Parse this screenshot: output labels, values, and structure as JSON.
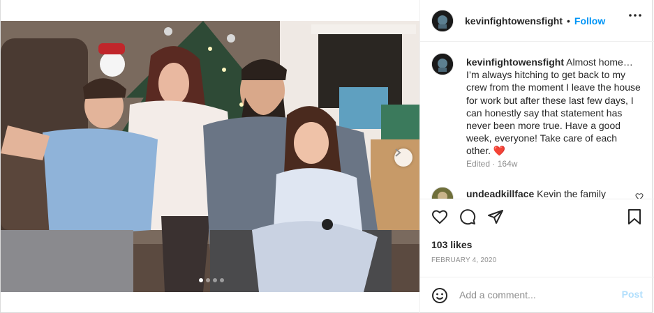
{
  "header": {
    "username": "kevinfightowensfight",
    "separator": "•",
    "follow_label": "Follow"
  },
  "caption": {
    "username": "kevinfightowensfight",
    "text": "Almost home… I’m always hitching to get back to my crew from the moment I leave the house for work but after these last few days, I can honestly say that statement has never been more true. Have a good week, everyone! Take care of each other.",
    "emoji": "❤️",
    "edited": "Edited",
    "dot": "·",
    "age": "164w"
  },
  "comments": [
    {
      "username": "undeadkillface",
      "text": "Kevin the family"
    }
  ],
  "likes": "103 likes",
  "date": "February 4, 2020",
  "add_comment": {
    "placeholder": "Add a comment...",
    "post_label": "Post"
  },
  "carousel": {
    "total": 4,
    "current": 1
  },
  "icons": {
    "more": "more-options-icon",
    "like": "heart-icon",
    "comment": "comment-icon",
    "share": "share-icon",
    "save": "bookmark-icon",
    "emoji": "emoji-icon",
    "next": "chevron-right-icon"
  },
  "colors": {
    "accent": "#0095f6",
    "post_disabled": "#b2dffc",
    "heart": "#ed4956",
    "muted": "#8e8e8e"
  }
}
